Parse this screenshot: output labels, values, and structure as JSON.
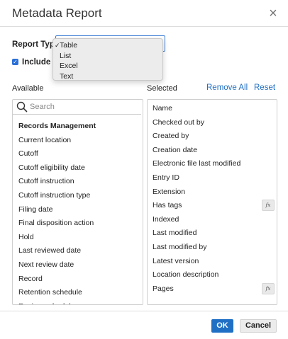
{
  "dialog": {
    "title": "Metadata Report",
    "close_icon": "close-icon"
  },
  "report_type": {
    "label": "Report Type",
    "selected": "Table",
    "options": [
      {
        "label": "Table",
        "checked": true
      },
      {
        "label": "List",
        "checked": false
      },
      {
        "label": "Excel",
        "checked": false
      },
      {
        "label": "Text",
        "checked": false
      }
    ],
    "check_mark": "✓"
  },
  "include": {
    "label": "Include s",
    "checked": true
  },
  "available": {
    "label": "Available",
    "search_placeholder": "Search",
    "items": [
      {
        "label": "Records Management",
        "header": true
      },
      {
        "label": "Current location"
      },
      {
        "label": "Cutoff"
      },
      {
        "label": "Cutoff eligibility date"
      },
      {
        "label": "Cutoff instruction"
      },
      {
        "label": "Cutoff instruction type"
      },
      {
        "label": "Filing date"
      },
      {
        "label": "Final disposition action"
      },
      {
        "label": "Hold"
      },
      {
        "label": "Last reviewed date"
      },
      {
        "label": "Next review date"
      },
      {
        "label": "Record"
      },
      {
        "label": "Retention schedule"
      },
      {
        "label": "Review schedule"
      }
    ]
  },
  "selected": {
    "label": "Selected",
    "remove_all": "Remove All",
    "reset": "Reset",
    "items": [
      {
        "label": "Name",
        "fx": false
      },
      {
        "label": "Checked out by",
        "fx": false
      },
      {
        "label": "Created by",
        "fx": false
      },
      {
        "label": "Creation date",
        "fx": false
      },
      {
        "label": "Electronic file last modified",
        "fx": false
      },
      {
        "label": "Entry ID",
        "fx": false
      },
      {
        "label": "Extension",
        "fx": false
      },
      {
        "label": "Has tags",
        "fx": true
      },
      {
        "label": "Indexed",
        "fx": false
      },
      {
        "label": "Last modified",
        "fx": false
      },
      {
        "label": "Last modified by",
        "fx": false
      },
      {
        "label": "Latest version",
        "fx": false
      },
      {
        "label": "Location description",
        "fx": false
      },
      {
        "label": "Pages",
        "fx": true
      }
    ],
    "fx_text": "fx"
  },
  "footer": {
    "ok": "OK",
    "cancel": "Cancel"
  },
  "colors": {
    "accent": "#1f6fc5",
    "checkbox": "#2a6fd6",
    "dropdown_bg": "#ececec"
  }
}
